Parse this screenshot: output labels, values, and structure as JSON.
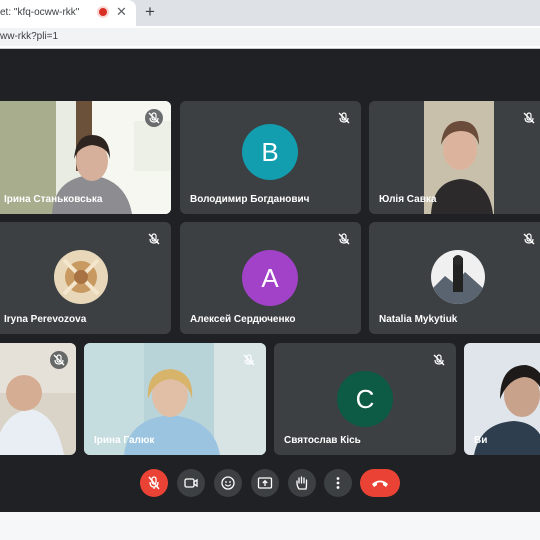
{
  "browser": {
    "tab_title": "et: \"kfq-ocww-rkk\"",
    "url": "ww-rkk?pli=1",
    "close_glyph": "✕",
    "new_tab_glyph": "+",
    "recording_color": "#d93025"
  },
  "participants": [
    {
      "name": "Ірина Станьковська",
      "kind": "video"
    },
    {
      "name": "Володимир Богданович",
      "kind": "avatar",
      "letter": "B",
      "color": "#129eaf"
    },
    {
      "name": "Юлія Савка",
      "kind": "video"
    },
    {
      "name": "Iryna Perevozova",
      "kind": "photo-avatar"
    },
    {
      "name": "Алексей Сердюченко",
      "kind": "avatar",
      "letter": "A",
      "color": "#a142c8"
    },
    {
      "name": "Natalia Mykytiuk",
      "kind": "photo-avatar"
    },
    {
      "name": "",
      "kind": "video"
    },
    {
      "name": "Ірина Галюк",
      "kind": "video"
    },
    {
      "name": "Святослав Кісь",
      "kind": "avatar",
      "letter": "C",
      "color": "#0d5b45"
    },
    {
      "name": "Ви",
      "kind": "video"
    }
  ],
  "controls": [
    {
      "icon": "mic-off-icon",
      "color": "#ea4335"
    },
    {
      "icon": "camera-icon"
    },
    {
      "icon": "emoji-icon"
    },
    {
      "icon": "present-screen-icon"
    },
    {
      "icon": "raise-hand-icon"
    },
    {
      "icon": "more-options-icon"
    },
    {
      "icon": "hang-up-icon",
      "color": "#ea4335"
    }
  ]
}
